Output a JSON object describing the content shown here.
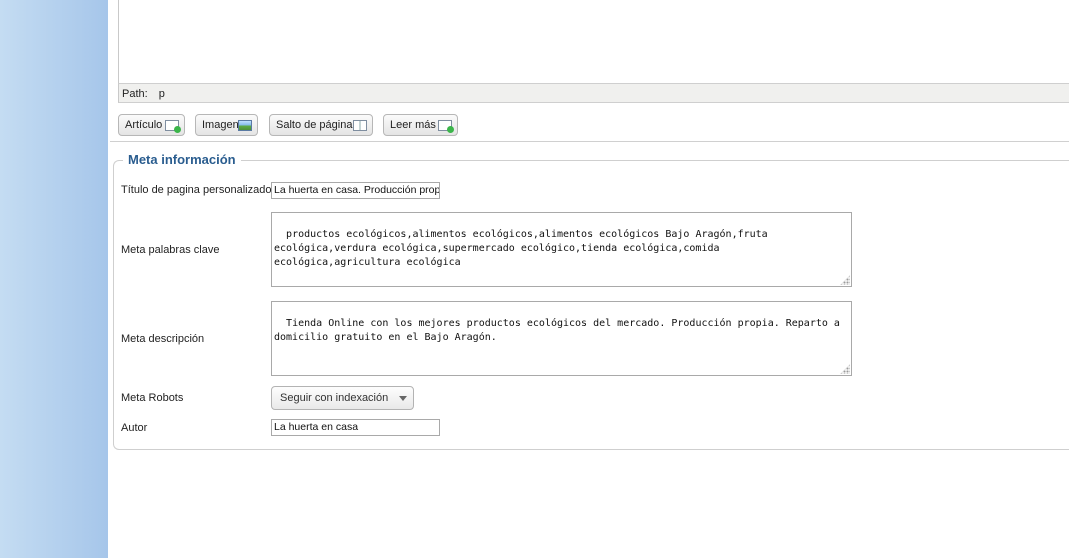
{
  "editor": {
    "path_label": "Path:",
    "path_value": "p",
    "buttons": [
      {
        "label": "Artículo",
        "icon": "article-insert-icon"
      },
      {
        "label": "Imagen",
        "icon": "image-insert-icon"
      },
      {
        "label": "Salto de página",
        "icon": "pagebreak-icon"
      },
      {
        "label": "Leer más",
        "icon": "readmore-icon"
      }
    ]
  },
  "meta": {
    "legend": "Meta información",
    "custom_title": {
      "label": "Título de pagina personalizado",
      "value": "La huerta en casa. Producción prop"
    },
    "keywords": {
      "label": "Meta palabras clave",
      "value": "productos ecológicos,alimentos ecológicos,alimentos ecológicos Bajo Aragón,fruta ecológica,verdura ecológica,supermercado ecológico,tienda ecológica,comida ecológica,agricultura ecológica"
    },
    "description": {
      "label": "Meta descripción",
      "value": "Tienda Online con los mejores productos ecológicos del mercado. Producción propia. Reparto a domicilio gratuito en el Bajo Aragón."
    },
    "robots": {
      "label": "Meta Robots",
      "selected": "Seguir con indexación"
    },
    "author": {
      "label": "Autor",
      "value": "La huerta en casa"
    }
  },
  "colors": {
    "legend": "#2a5d8f",
    "sidebar_gradient_start": "#c4dcf2",
    "sidebar_gradient_end": "#a6c6ea"
  }
}
